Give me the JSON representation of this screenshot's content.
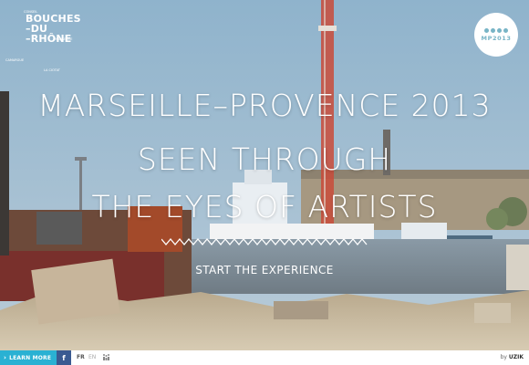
{
  "logo_left": {
    "lines": [
      "BOUCHES",
      "–DU",
      "–RHÔNE"
    ],
    "small_top": "CONSEIL",
    "small_mid": "MARSEILLE",
    "small_left": "CAMARGUE",
    "small_bottom": "LA CIOTAT"
  },
  "logo_right": {
    "text": "MP2013"
  },
  "headline": {
    "line1": "MARSEILLE–PROVENCE 2013",
    "line2": "SEEN THROUGH",
    "line3": "THE EYES OF ARTISTS"
  },
  "cta": {
    "label": "START THE EXPERIENCE"
  },
  "bottom_bar": {
    "learn_more": "LEARN MORE",
    "facebook": "f",
    "lang_fr": "FR",
    "lang_en": "EN",
    "accessibility_icon": "accessibility-icon",
    "credit_prefix": "by",
    "credit_brand": "UZIK"
  },
  "colors": {
    "accent_blue": "#2ab1d3",
    "facebook_blue": "#3a5a91",
    "mp_logo_dot": "#78b4c6"
  }
}
